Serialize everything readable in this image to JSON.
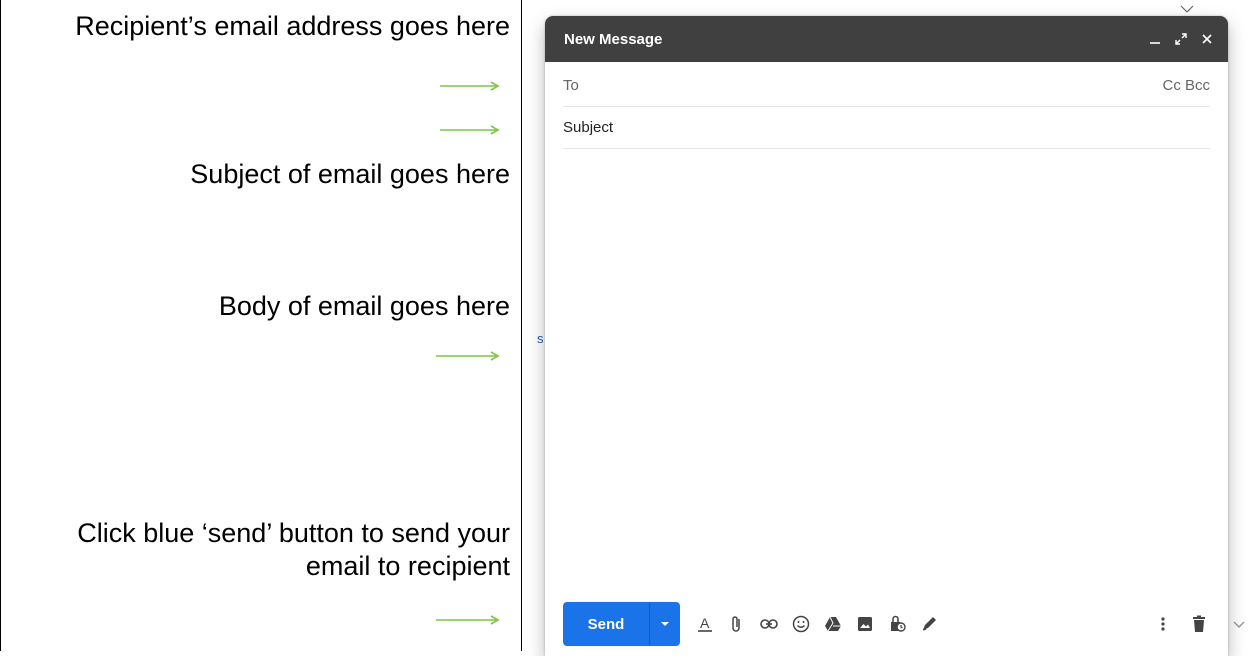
{
  "annotations": {
    "recipient": "Recipient’s email address goes here",
    "subject": "Subject of email goes here",
    "body": "Body of email goes here",
    "send": "Click blue ‘send’ button to send your email to recipient"
  },
  "compose": {
    "title": "New Message",
    "to_label": "To",
    "cc_bcc": "Cc Bcc",
    "subject_label": "Subject",
    "send_label": "Send"
  },
  "background": {
    "frag_s": "s"
  },
  "colors": {
    "header": "#404040",
    "send": "#1a73e8",
    "arrow": "#7ac943"
  },
  "icons": [
    "minimize-icon",
    "expand-icon",
    "close-icon",
    "text-format-icon",
    "attach-icon",
    "link-icon",
    "emoji-icon",
    "drive-icon",
    "photo-icon",
    "confidential-icon",
    "signature-icon",
    "more-options-icon",
    "trash-icon"
  ]
}
